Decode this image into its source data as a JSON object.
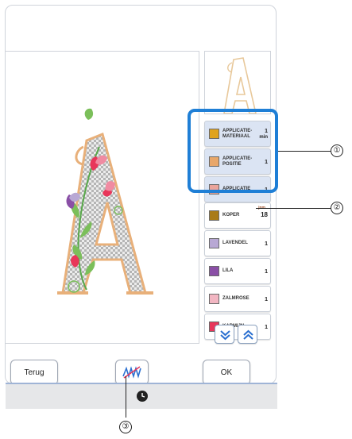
{
  "toolbar": {
    "back_label": "Terug",
    "ok_label": "OK"
  },
  "color_list": [
    {
      "name": "APPLICATIE-\nMATERIAAL",
      "count": "1",
      "unit": "min",
      "color": "#e0a31d",
      "selected": true
    },
    {
      "name": "APPLICATIE-\nPOSITIE",
      "count": "1",
      "color": "#e8a76a",
      "selected": true
    },
    {
      "name": "APPLICATIE",
      "count": "1",
      "color": "#eaa49a",
      "selected": true
    },
    {
      "name": "KOPER",
      "count": "18",
      "mini": "jnm",
      "color": "#a97b18",
      "selected": false
    },
    {
      "name": "LAVENDEL",
      "count": "1",
      "color": "#b8a8d4",
      "selected": false
    },
    {
      "name": "LILA",
      "count": "1",
      "color": "#8a4fa6",
      "selected": false
    },
    {
      "name": "ZALMROSE",
      "count": "1",
      "color": "#f2b6c2",
      "selected": false
    },
    {
      "name": "KARMIJN",
      "count": "1",
      "color": "#e8365a",
      "selected": false
    }
  ],
  "callouts": {
    "c1": "①",
    "c2": "②",
    "c3": "③"
  },
  "colors": {
    "highlight": "#1f7fd6",
    "accent_blue": "#2a6fd0"
  },
  "icons": {
    "scroll_down": "double-chevron-down-icon",
    "scroll_up": "double-chevron-up-icon",
    "stitch_toggle": "stitch-toggle-icon",
    "clock": "clock-icon"
  }
}
